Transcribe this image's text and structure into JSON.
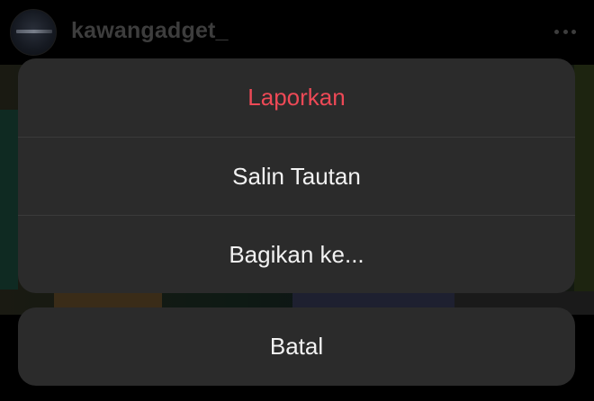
{
  "post": {
    "username": "kawangadget_",
    "more_icon": "more-horizontal-icon"
  },
  "action_sheet": {
    "items": [
      {
        "label": "Laporkan",
        "style": "destructive",
        "color": "#ed4956"
      },
      {
        "label": "Salin Tautan",
        "style": "default",
        "color": "#f2f2f2"
      },
      {
        "label": "Bagikan ke...",
        "style": "default",
        "color": "#f2f2f2"
      }
    ],
    "cancel_label": "Batal"
  }
}
